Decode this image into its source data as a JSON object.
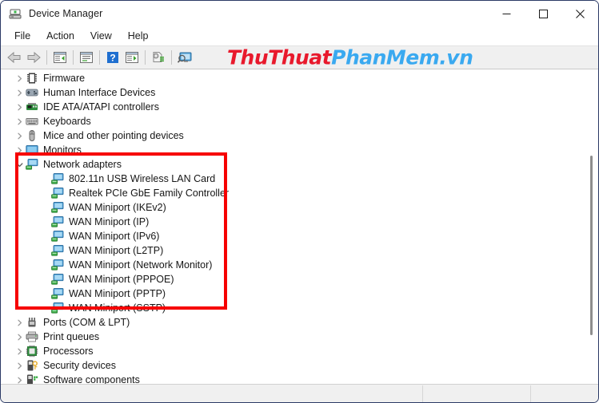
{
  "window": {
    "title": "Device Manager",
    "icon": "device-manager-icon",
    "controls": {
      "minimize": "–",
      "maximize": "□",
      "close": "✕"
    }
  },
  "menubar": {
    "items": [
      {
        "label": "File"
      },
      {
        "label": "Action"
      },
      {
        "label": "View"
      },
      {
        "label": "Help"
      }
    ]
  },
  "toolbar": {
    "buttons": [
      {
        "name": "back-arrow-icon"
      },
      {
        "name": "forward-arrow-icon"
      },
      {
        "name": "show-hide-console-tree-icon"
      },
      {
        "name": "properties-icon"
      },
      {
        "name": "help-icon"
      },
      {
        "name": "update-driver-icon"
      },
      {
        "name": "uninstall-device-icon"
      },
      {
        "name": "scan-hardware-changes-icon"
      }
    ]
  },
  "watermark": {
    "part1": "ThuThuat",
    "part2": "PhanMem.vn",
    "color1": "#e8192c",
    "color2": "#3aa9f0"
  },
  "tree": {
    "nodes": [
      {
        "label": "Firmware",
        "icon": "firmware-icon",
        "level": 1,
        "expanded": false,
        "highlighted": false
      },
      {
        "label": "Human Interface Devices",
        "icon": "hid-icon",
        "level": 1,
        "expanded": false,
        "highlighted": false
      },
      {
        "label": "IDE ATA/ATAPI controllers",
        "icon": "ide-controller-icon",
        "level": 1,
        "expanded": false,
        "highlighted": false
      },
      {
        "label": "Keyboards",
        "icon": "keyboard-icon",
        "level": 1,
        "expanded": false,
        "highlighted": false
      },
      {
        "label": "Mice and other pointing devices",
        "icon": "mouse-icon",
        "level": 1,
        "expanded": false,
        "highlighted": false
      },
      {
        "label": "Monitors",
        "icon": "monitor-icon",
        "level": 1,
        "expanded": false,
        "highlighted": false
      },
      {
        "label": "Network adapters",
        "icon": "network-adapter-icon",
        "level": 1,
        "expanded": true,
        "highlighted": true
      },
      {
        "label": "802.11n USB Wireless LAN Card",
        "icon": "network-adapter-icon",
        "level": 2,
        "expanded": null,
        "highlighted": true
      },
      {
        "label": "Realtek PCIe GbE Family Controller",
        "icon": "network-adapter-icon",
        "level": 2,
        "expanded": null,
        "highlighted": true
      },
      {
        "label": "WAN Miniport (IKEv2)",
        "icon": "network-adapter-icon",
        "level": 2,
        "expanded": null,
        "highlighted": true
      },
      {
        "label": "WAN Miniport (IP)",
        "icon": "network-adapter-icon",
        "level": 2,
        "expanded": null,
        "highlighted": true
      },
      {
        "label": "WAN Miniport (IPv6)",
        "icon": "network-adapter-icon",
        "level": 2,
        "expanded": null,
        "highlighted": true
      },
      {
        "label": "WAN Miniport (L2TP)",
        "icon": "network-adapter-icon",
        "level": 2,
        "expanded": null,
        "highlighted": true
      },
      {
        "label": "WAN Miniport (Network Monitor)",
        "icon": "network-adapter-icon",
        "level": 2,
        "expanded": null,
        "highlighted": true
      },
      {
        "label": "WAN Miniport (PPPOE)",
        "icon": "network-adapter-icon",
        "level": 2,
        "expanded": null,
        "highlighted": true
      },
      {
        "label": "WAN Miniport (PPTP)",
        "icon": "network-adapter-icon",
        "level": 2,
        "expanded": null,
        "highlighted": true
      },
      {
        "label": "WAN Miniport (SSTP)",
        "icon": "network-adapter-icon",
        "level": 2,
        "expanded": null,
        "highlighted": true
      },
      {
        "label": "Ports (COM & LPT)",
        "icon": "port-icon",
        "level": 1,
        "expanded": false,
        "highlighted": false
      },
      {
        "label": "Print queues",
        "icon": "printer-icon",
        "level": 1,
        "expanded": false,
        "highlighted": false
      },
      {
        "label": "Processors",
        "icon": "processor-icon",
        "level": 1,
        "expanded": false,
        "highlighted": false
      },
      {
        "label": "Security devices",
        "icon": "security-device-icon",
        "level": 1,
        "expanded": false,
        "highlighted": false
      },
      {
        "label": "Software components",
        "icon": "software-component-icon",
        "level": 1,
        "expanded": false,
        "highlighted": false
      }
    ]
  },
  "annotation": {
    "highlight_color": "#f60000"
  },
  "statusbar": {
    "text": ""
  }
}
